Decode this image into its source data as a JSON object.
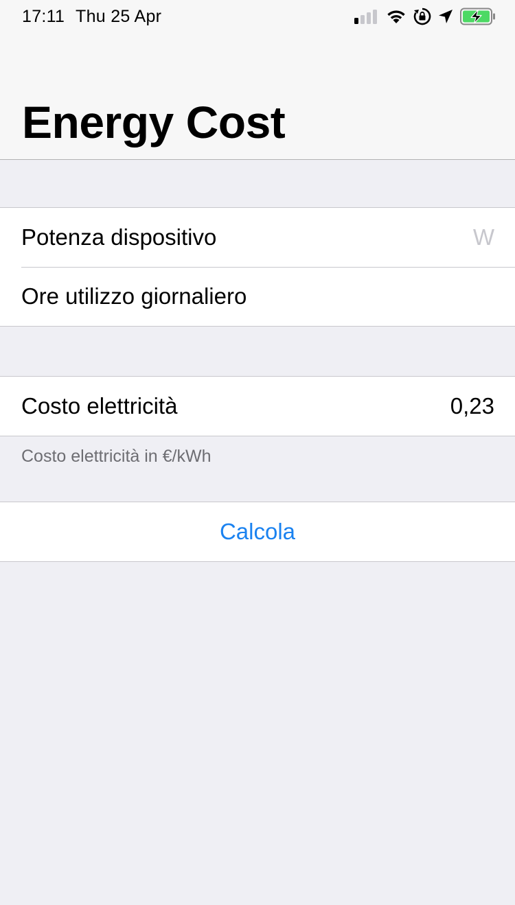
{
  "status_bar": {
    "time": "17:11",
    "date": "Thu 25 Apr",
    "icons": [
      "cellular-signal-icon",
      "wifi-icon",
      "orientation-lock-icon",
      "location-icon",
      "battery-charging-icon"
    ],
    "battery_color": "#4cd964"
  },
  "nav": {
    "title": "Energy Cost"
  },
  "section_inputs": {
    "power": {
      "label": "Potenza dispositivo",
      "placeholder": "W",
      "value": ""
    },
    "hours": {
      "label": "Ore utilizzo giornaliero",
      "placeholder": "",
      "value": ""
    }
  },
  "section_cost": {
    "cost": {
      "label": "Costo elettricità",
      "value": "0,23"
    },
    "footer": "Costo elettricità in €/kWh"
  },
  "calculate": {
    "label": "Calcola",
    "color": "#1a82f0"
  }
}
